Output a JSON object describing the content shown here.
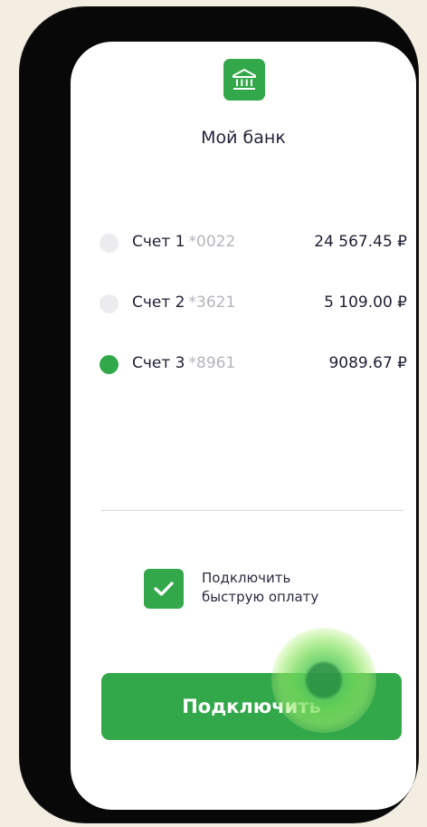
{
  "app": {
    "title": "Мой банк",
    "logo_icon": "bank-building-icon"
  },
  "accounts": [
    {
      "name": "Счет 1",
      "number": "*0022",
      "amount": "24 567.45 ₽",
      "selected": false
    },
    {
      "name": "Счет 2",
      "number": "*3621",
      "amount": "5 109.00 ₽",
      "selected": false
    },
    {
      "name": "Счет 3",
      "number": "*8961",
      "amount": "9089.67 ₽",
      "selected": true
    }
  ],
  "fast_pay": {
    "label_line1": "Подключить",
    "label_line2": "быструю оплату",
    "checked": true,
    "check_icon": "checkmark-icon"
  },
  "connect_button": {
    "label": "Подключить"
  },
  "colors": {
    "accent": "#33a84a",
    "background": "#f3ede2",
    "phone_frame": "#080808",
    "text": "#1e1f33",
    "muted": "#b4b4bc",
    "radio_inactive": "#ececef"
  }
}
